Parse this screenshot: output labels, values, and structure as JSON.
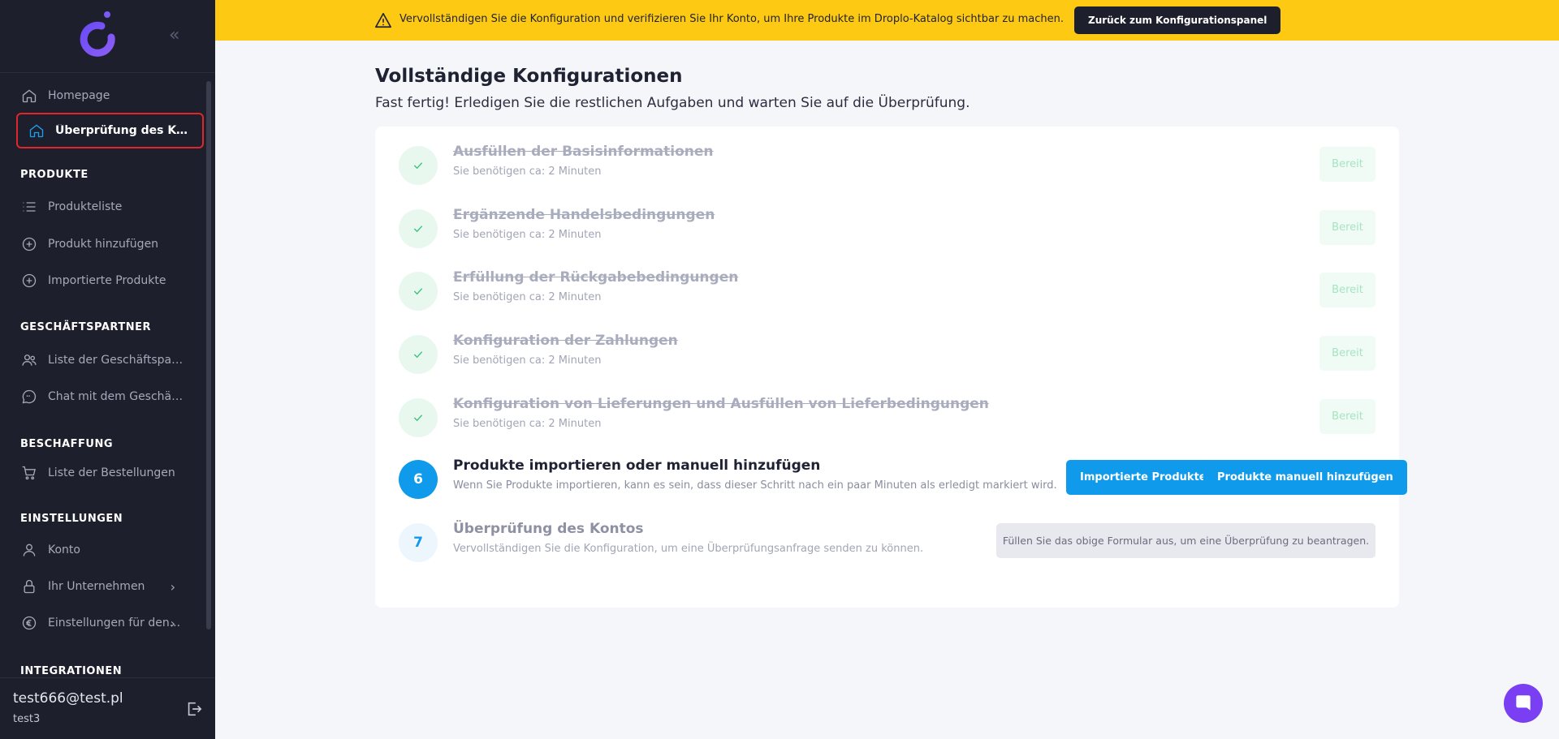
{
  "sidebar": {
    "collapse_icon": "double-chevron-left-icon",
    "nav": {
      "homepage": "Homepage",
      "account_verification": "Überprüfung des Kontos"
    },
    "sections": {
      "products": {
        "title": "PRODUKTE",
        "items": [
          "Produkteliste",
          "Produkt hinzufügen",
          "Importierte Produkte"
        ]
      },
      "partners": {
        "title": "GESCHÄFTSPARTNER",
        "items": [
          "Liste der Geschäftspartn...",
          "Chat mit dem Geschäfts..."
        ]
      },
      "procurement": {
        "title": "BESCHAFFUNG",
        "items": [
          "Liste der Bestellungen"
        ]
      },
      "settings": {
        "title": "EINSTELLUNGEN",
        "items": [
          "Konto",
          "Ihr Unternehmen",
          "Einstellungen für den..."
        ]
      },
      "integrations": {
        "title": "INTEGRATIONEN"
      }
    },
    "user": {
      "email": "test666@test.pl",
      "name": "test3"
    }
  },
  "banner": {
    "text": "Vervollständigen Sie die Konfiguration und verifizieren Sie Ihr Konto, um Ihre Produkte im Droplo-Katalog sichtbar zu machen.",
    "button": "Zurück zum Konfigurationspanel",
    "color": "#fdc912"
  },
  "main": {
    "title": "Vollständige Konfigurationen",
    "subtitle": "Fast fertig! Erledigen Sie die restlichen Aufgaben und warten Sie auf die Überprüfung.",
    "steps": [
      {
        "title": "Ausfüllen der Basisinformationen",
        "desc": "Sie benötigen ca: 2 Minuten",
        "status": "done",
        "action": "Bereit"
      },
      {
        "title": "Ergänzende Handelsbedingungen",
        "desc": "Sie benötigen ca: 2 Minuten",
        "status": "done",
        "action": "Bereit"
      },
      {
        "title": "Erfüllung der Rückgabebedingungen",
        "desc": "Sie benötigen ca: 2 Minuten",
        "status": "done",
        "action": "Bereit"
      },
      {
        "title": "Konfiguration der Zahlungen",
        "desc": "Sie benötigen ca: 2 Minuten",
        "status": "done",
        "action": "Bereit"
      },
      {
        "title": "Konfiguration von Lieferungen und Ausfüllen von Lieferbedingungen",
        "desc": "Sie benötigen ca: 2 Minuten",
        "status": "done",
        "action": "Bereit"
      },
      {
        "number": "6",
        "title": "Produkte importieren oder manuell hinzufügen",
        "desc": "Wenn Sie Produkte importieren, kann es sein, dass dieser Schritt nach ein paar Minuten als erledigt markiert wird.",
        "status": "current",
        "action_primary": "Importierte Produkte",
        "action_secondary": "Produkte manuell hinzufügen"
      },
      {
        "number": "7",
        "title": "Überprüfung des Kontos",
        "desc": "Vervollständigen Sie die Konfiguration, um eine Überprüfungsanfrage senden zu können.",
        "status": "pending",
        "action_info": "Füllen Sie das obige Formular aus, um eine Überprüfung zu beantragen."
      }
    ]
  },
  "colors": {
    "sidebar_bg": "#1e1f2c",
    "accent_blue": "#0f9aeb",
    "done_green": "#34c27a",
    "chat_purple": "#7a3ff2"
  }
}
